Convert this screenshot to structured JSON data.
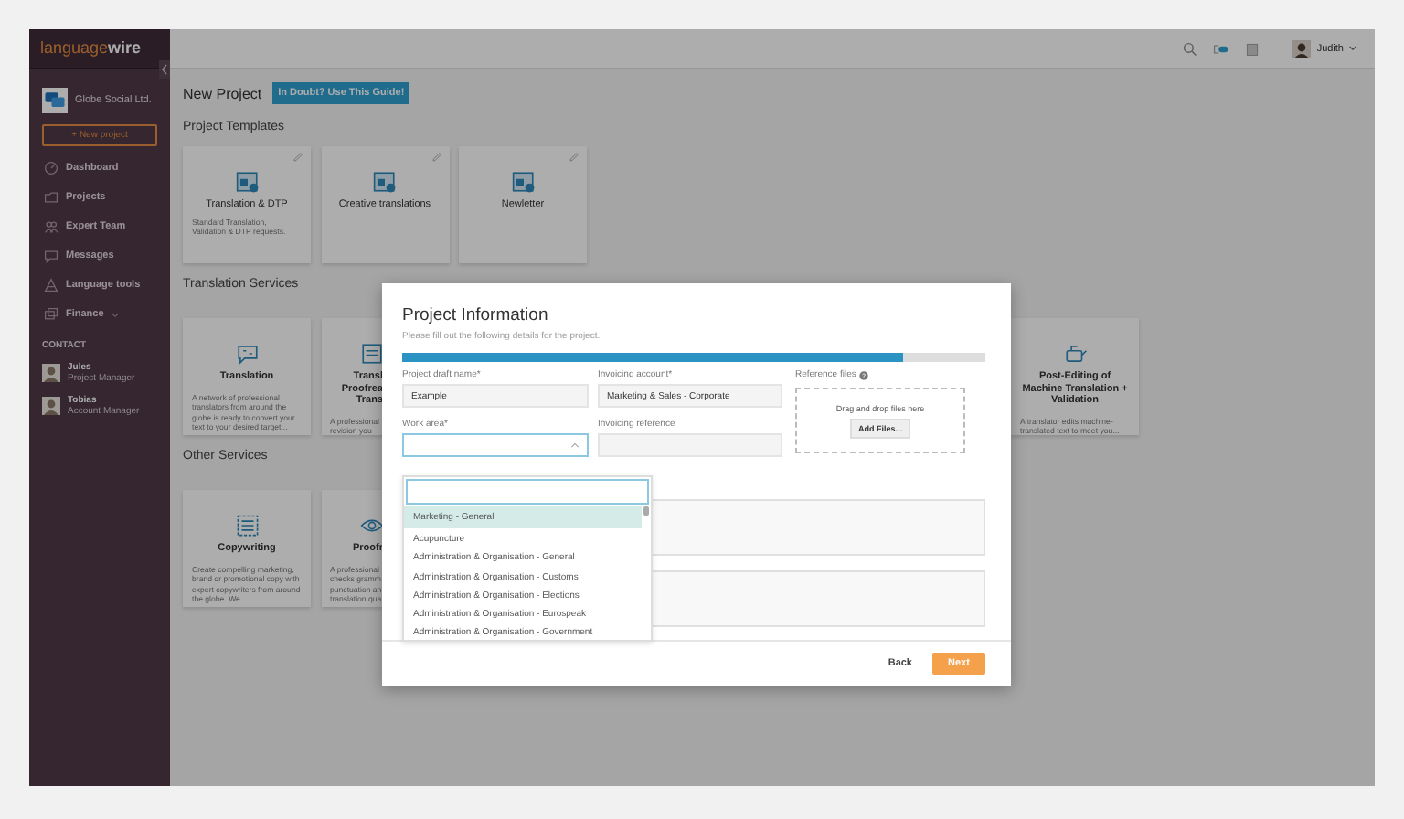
{
  "topbar": {
    "user": "Judith"
  },
  "sidebar": {
    "logo": {
      "light": "language",
      "bold": "wire"
    },
    "company": "Globe Social Ltd.",
    "new_project": "+ New project",
    "nav": [
      {
        "kind": "dashboard",
        "label": "Dashboard",
        "submenu": false
      },
      {
        "kind": "projects",
        "label": "Projects",
        "submenu": false
      },
      {
        "kind": "team",
        "label": "Expert Team",
        "submenu": false
      },
      {
        "kind": "messages",
        "label": "Messages",
        "submenu": false
      },
      {
        "kind": "tools",
        "label": "Language tools",
        "submenu": false
      },
      {
        "kind": "finance",
        "label": "Finance",
        "submenu": true
      }
    ],
    "contact_heading": "CONTACT",
    "contacts": [
      {
        "name": "Jules",
        "role": "Project Manager"
      },
      {
        "name": "Tobias",
        "role": "Account Manager"
      }
    ]
  },
  "main": {
    "title": "New Project",
    "guide_button": "In Doubt? Use This Guide!",
    "sections": [
      {
        "heading": "Project Templates",
        "cards": [
          {
            "kind": "template",
            "cut": false,
            "title": "Translation & DTP",
            "description": "Standard Translation, Validation & DTP requests."
          },
          {
            "kind": "template",
            "cut": false,
            "title": "Creative translations"
          },
          {
            "kind": "template",
            "cut": false,
            "title": "Newletter"
          }
        ]
      },
      {
        "heading": "Translation Services",
        "cards": [
          {
            "kind": "translation",
            "cut": false,
            "title": "Translation",
            "description": "A network of professional translators from around the globe is ready to convert your text to your desired target..."
          },
          {
            "kind": "document",
            "cut": true,
            "title": "Transl\nProofrea\nTrans",
            "description": "A professional\nrevision you"
          },
          {
            "kind": "post-editing",
            "cut": false,
            "title": "Post-Editing of Machine Translation + Validation",
            "description": "A translator edits machine-translated text to meet you..."
          }
        ]
      },
      {
        "heading": "Other Services",
        "cards": [
          {
            "kind": "copywriting",
            "cut": false,
            "title": "Copywriting",
            "description": "Create compelling marketing, brand or promotional copy with expert copywriters from around the globe. We..."
          },
          {
            "kind": "proofreading",
            "cut": true,
            "title": "Proofr",
            "description": "A professional\nchecks gramm\npunctuation an\ntranslation qua"
          }
        ]
      }
    ]
  },
  "modal": {
    "title": "Project Information",
    "subtitle": "Please fill out the following details for the project.",
    "progress": {
      "level": 0.86
    },
    "fields": [
      {
        "kind": "text",
        "label": "Project draft name*",
        "value": "Example",
        "focused": false
      },
      {
        "kind": "text",
        "label": "Invoicing account*",
        "value": "Marketing & Sales - Corporate",
        "focused": false
      },
      {
        "kind": "select",
        "label": "Work area*",
        "focused": true,
        "open": true
      },
      {
        "kind": "text",
        "label": "Invoicing reference",
        "focused": false
      }
    ],
    "reference_files": {
      "label": "Reference files",
      "drop_hint": "Drag and drop files here",
      "button": "Add Files..."
    },
    "text_areas": [
      {
        "kind": "textarea"
      },
      {
        "kind": "textarea"
      }
    ],
    "dropdown": {
      "options": [
        {
          "label": "Marketing - General",
          "selected": true
        },
        {
          "label": "Acupuncture",
          "selected": false
        },
        {
          "label": "Administration & Organisation - General",
          "selected": false
        },
        {
          "label": "Administration & Organisation - Customs",
          "selected": false
        },
        {
          "label": "Administration & Organisation - Elections",
          "selected": false
        },
        {
          "label": "Administration & Organisation - Eurospeak",
          "selected": false
        },
        {
          "label": "Administration & Organisation - Government",
          "selected": false
        }
      ]
    },
    "buttons": {
      "back": "Back",
      "next": "Next"
    }
  }
}
